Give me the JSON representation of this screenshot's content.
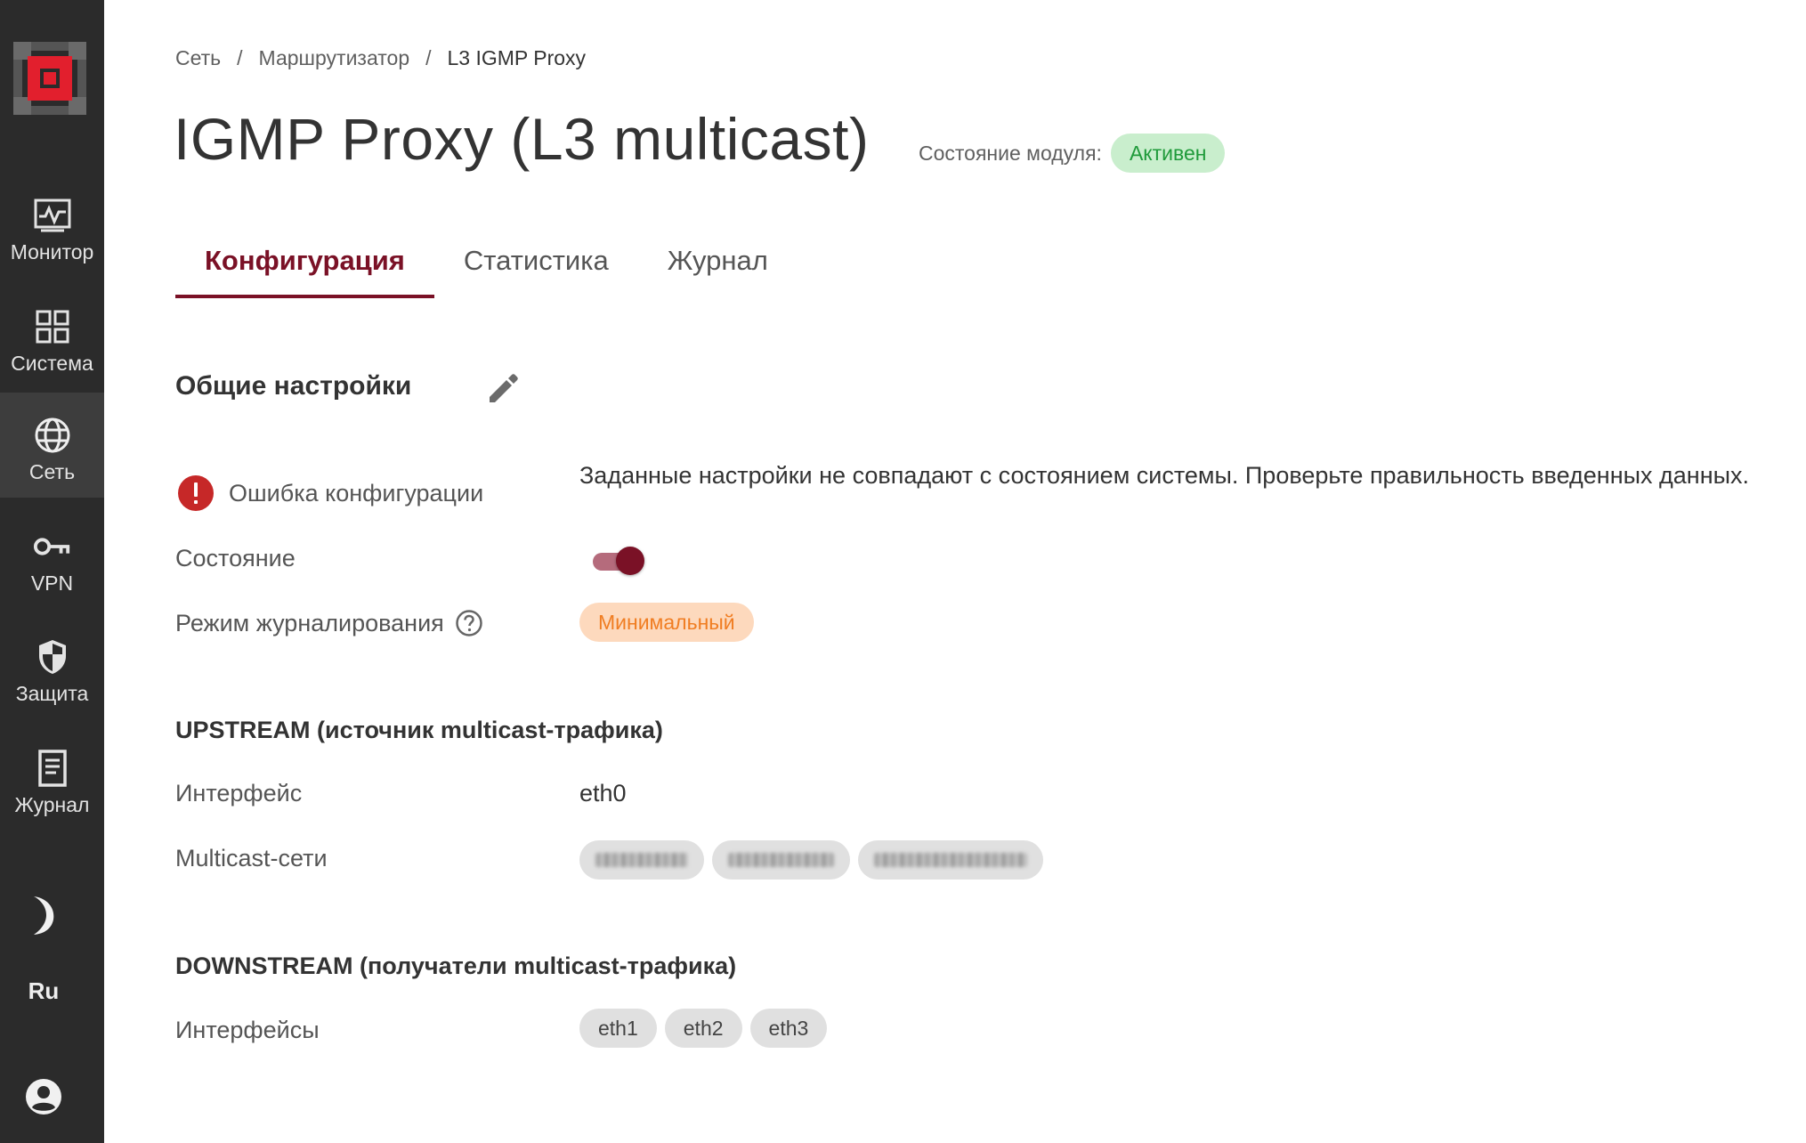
{
  "sidebar": {
    "logo_name": "app-logo",
    "items": [
      {
        "label": "Монитор",
        "icon": "monitor-icon"
      },
      {
        "label": "Система",
        "icon": "grid-icon"
      },
      {
        "label": "Сеть",
        "icon": "globe-icon",
        "active": true
      },
      {
        "label": "VPN",
        "icon": "key-icon"
      },
      {
        "label": "Защита",
        "icon": "shield-icon"
      },
      {
        "label": "Журнал",
        "icon": "document-icon"
      }
    ],
    "theme_icon": "moon-icon",
    "language": "Ru",
    "account_icon": "account-icon"
  },
  "breadcrumb": [
    "Сеть",
    "Маршрутизатор",
    "L3 IGMP Proxy"
  ],
  "breadcrumb_separator": "/",
  "page": {
    "title": "IGMP Proxy (L3 multicast)",
    "module_state_label": "Состояние модуля:",
    "module_state_value": "Активен"
  },
  "tabs": [
    {
      "label": "Конфигурация",
      "active": true
    },
    {
      "label": "Статистика",
      "active": false
    },
    {
      "label": "Журнал",
      "active": false
    }
  ],
  "general": {
    "title": "Общие настройки",
    "error_label": "Ошибка конфигурации",
    "error_message": "Заданные настройки не совпадают с состоянием системы. Проверьте правильность введенных данных.",
    "state_label": "Состояние",
    "state_enabled": true,
    "log_mode_label": "Режим журналирования",
    "log_mode_value": "Минимальный"
  },
  "upstream": {
    "title": "UPSTREAM (источник multicast-трафика)",
    "interface_label": "Интерфейс",
    "interface_value": "eth0",
    "networks_label": "Multicast-сети",
    "networks": [
      "",
      "",
      ""
    ]
  },
  "downstream": {
    "title": "DOWNSTREAM (получатели multicast-трафика)",
    "interfaces_label": "Интерфейсы",
    "interfaces": [
      "eth1",
      "eth2",
      "eth3"
    ]
  },
  "colors": {
    "sidebar_bg": "#2b2b2b",
    "accent": "#7a1126",
    "active_badge_bg": "#c9eecd",
    "active_badge_text": "#1f9a3a",
    "min_badge_bg": "#fdd9bd",
    "min_badge_text": "#f07d22",
    "error": "#c62828"
  }
}
